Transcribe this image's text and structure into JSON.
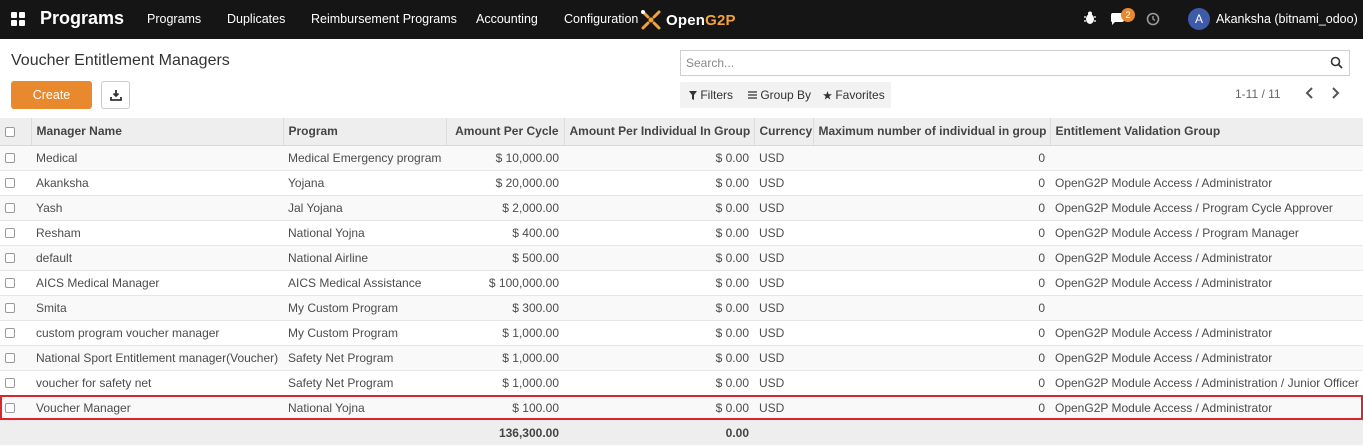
{
  "navbar": {
    "brand": "Programs",
    "menu": [
      "Programs",
      "Duplicates",
      "Reimbursement Programs",
      "Accounting",
      "Configuration"
    ],
    "logo_open": "Open",
    "logo_g2p": "G2P",
    "message_count": "2",
    "user_initial": "A",
    "user_name": "Akanksha (bitnami_odoo)"
  },
  "control_panel": {
    "title": "Voucher Entitlement Managers",
    "create_label": "Create",
    "search_placeholder": "Search...",
    "filters_label": "Filters",
    "group_by_label": "Group By",
    "favorites_label": "Favorites",
    "pager": "1-11 / 11"
  },
  "table": {
    "headers": [
      "Manager Name",
      "Program",
      "Amount Per Cycle",
      "Amount Per Individual In Group",
      "Currency",
      "Maximum number of individual in group",
      "Entitlement Validation Group"
    ],
    "rows": [
      [
        "Medical",
        "Medical Emergency program",
        "$ 10,000.00",
        "$ 0.00",
        "USD",
        "0",
        ""
      ],
      [
        "Akanksha",
        "Yojana",
        "$ 20,000.00",
        "$ 0.00",
        "USD",
        "0",
        "OpenG2P Module Access / Administrator"
      ],
      [
        "Yash",
        "Jal Yojana",
        "$ 2,000.00",
        "$ 0.00",
        "USD",
        "0",
        "OpenG2P Module Access / Program Cycle Approver"
      ],
      [
        "Resham",
        "National Yojna",
        "$ 400.00",
        "$ 0.00",
        "USD",
        "0",
        "OpenG2P Module Access / Program Manager"
      ],
      [
        "default",
        "National Airline",
        "$ 500.00",
        "$ 0.00",
        "USD",
        "0",
        "OpenG2P Module Access / Administrator"
      ],
      [
        "AICS Medical Manager",
        "AICS Medical Assistance",
        "$ 100,000.00",
        "$ 0.00",
        "USD",
        "0",
        "OpenG2P Module Access / Administrator"
      ],
      [
        "Smita",
        "My Custom Program",
        "$ 300.00",
        "$ 0.00",
        "USD",
        "0",
        ""
      ],
      [
        "custom program voucher manager",
        "My Custom Program",
        "$ 1,000.00",
        "$ 0.00",
        "USD",
        "0",
        "OpenG2P Module Access / Administrator"
      ],
      [
        "National Sport Entitlement manager(Voucher)",
        "Safety Net Program",
        "$ 1,000.00",
        "$ 0.00",
        "USD",
        "0",
        "OpenG2P Module Access / Administrator"
      ],
      [
        "voucher for safety net",
        "Safety Net Program",
        "$ 1,000.00",
        "$ 0.00",
        "USD",
        "0",
        "OpenG2P Module Access / Administration / Junior Officer"
      ],
      [
        "Voucher Manager",
        "National Yojna",
        "$ 100.00",
        "$ 0.00",
        "USD",
        "0",
        "OpenG2P Module Access / Administrator"
      ]
    ],
    "totals": {
      "amount_per_cycle": "136,300.00",
      "amount_per_individual": "0.00"
    },
    "highlight_color": "#d9262e"
  },
  "colors": {
    "accent": "#e8892e",
    "navbar": "#151515",
    "avatar": "#3d5ba9"
  }
}
